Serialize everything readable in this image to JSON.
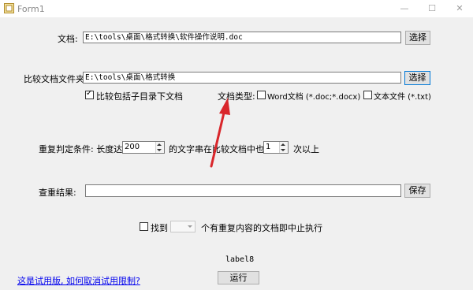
{
  "window": {
    "title": "Form1",
    "minimize": "—",
    "maximize": "☐",
    "close": "✕"
  },
  "doc_row": {
    "label": "文档:",
    "value": "E:\\tools\\桌面\\格式转换\\软件操作说明.doc",
    "button": "选择"
  },
  "folder_row": {
    "label": "比较文档文件夹:",
    "value": "E:\\tools\\桌面\\格式转换",
    "button": "选择"
  },
  "options": {
    "include_subdirs": {
      "label": "比较包括子目录下文档",
      "checked": true
    },
    "doc_type_label": "文档类型:",
    "word": {
      "label": "Word文档 (*.doc;*.docx)",
      "checked": false
    },
    "text": {
      "label": "文本文件 (*.txt)",
      "checked": false
    }
  },
  "condition": {
    "label": "重复判定条件: 长度达到",
    "length": "200",
    "middle": "的文字串在比较文档中也出现",
    "count": "1",
    "suffix": "次以上"
  },
  "result": {
    "label": "查重结果:",
    "value": "",
    "button": "保存"
  },
  "stop": {
    "checkbox_label": "找到",
    "count": "",
    "suffix": "个有重复内容的文档即中止执行",
    "checked": false
  },
  "status_label": "label8",
  "trial_link": "这是试用版, 如何取消试用限制?",
  "run_button": "运行",
  "annotation_color": "#d9262b"
}
